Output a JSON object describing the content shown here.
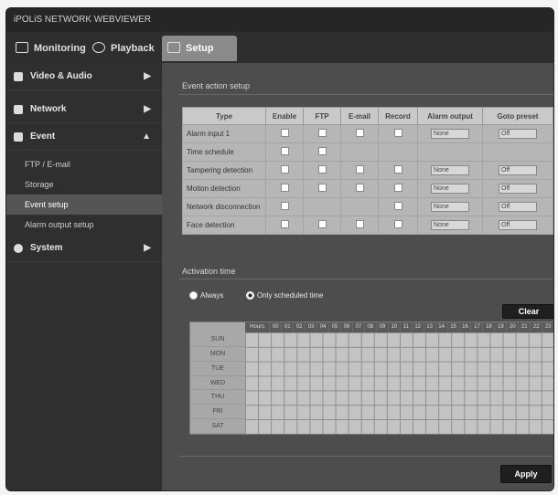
{
  "window": {
    "title": "iPOLiS NETWORK WEBVIEWER"
  },
  "tabs": [
    {
      "label": "Monitoring",
      "icon": "monitor-icon",
      "active": false
    },
    {
      "label": "Playback",
      "icon": "playback-icon",
      "active": false
    },
    {
      "label": "Setup",
      "icon": "setup-icon",
      "active": true
    }
  ],
  "sidebar": {
    "menus": [
      {
        "label": "Video & Audio",
        "arrow": "▶"
      },
      {
        "label": "Network",
        "arrow": "▶"
      },
      {
        "label": "Event",
        "arrow": "▲"
      }
    ],
    "event_subitems": [
      "FTP / E-mail",
      "Storage",
      "Event setup",
      "Alarm output setup"
    ],
    "active_subitem": "Event setup",
    "system": {
      "label": "System",
      "arrow": "▶"
    }
  },
  "event_section": {
    "title": "Event action setup",
    "columns": [
      "Type",
      "Enable",
      "FTP",
      "E-mail",
      "Record",
      "Alarm output",
      "Goto preset"
    ],
    "rows": [
      {
        "name": "Alarm input 1",
        "checks": [
          true,
          true,
          true,
          true
        ],
        "alarm": "None",
        "preset": "Off"
      },
      {
        "name": "Time schedule",
        "checks": [
          true,
          true,
          false,
          false
        ],
        "alarm": "",
        "preset": ""
      },
      {
        "name": "Tampering detection",
        "checks": [
          true,
          true,
          true,
          true
        ],
        "alarm": "None",
        "preset": "Off"
      },
      {
        "name": "Motion detection",
        "checks": [
          true,
          true,
          true,
          true
        ],
        "alarm": "None",
        "preset": "Off"
      },
      {
        "name": "Network disconnection",
        "checks": [
          true,
          false,
          false,
          true
        ],
        "alarm": "None",
        "preset": "Off"
      },
      {
        "name": "Face detection",
        "checks": [
          true,
          true,
          true,
          true
        ],
        "alarm": "None",
        "preset": "Off"
      }
    ]
  },
  "schedule_section": {
    "title": "Activation time",
    "radio_always": "Always",
    "radio_scheduled": "Only scheduled time",
    "clear_label": "Clear",
    "hours": [
      "Hours",
      "00",
      "01",
      "02",
      "03",
      "04",
      "05",
      "06",
      "07",
      "08",
      "09",
      "10",
      "11",
      "12",
      "13",
      "14",
      "15",
      "16",
      "17",
      "18",
      "19",
      "20",
      "21",
      "22",
      "23"
    ],
    "days": [
      "SUN",
      "MON",
      "TUE",
      "WED",
      "THU",
      "FRI",
      "SAT"
    ]
  },
  "apply_label": "Apply"
}
